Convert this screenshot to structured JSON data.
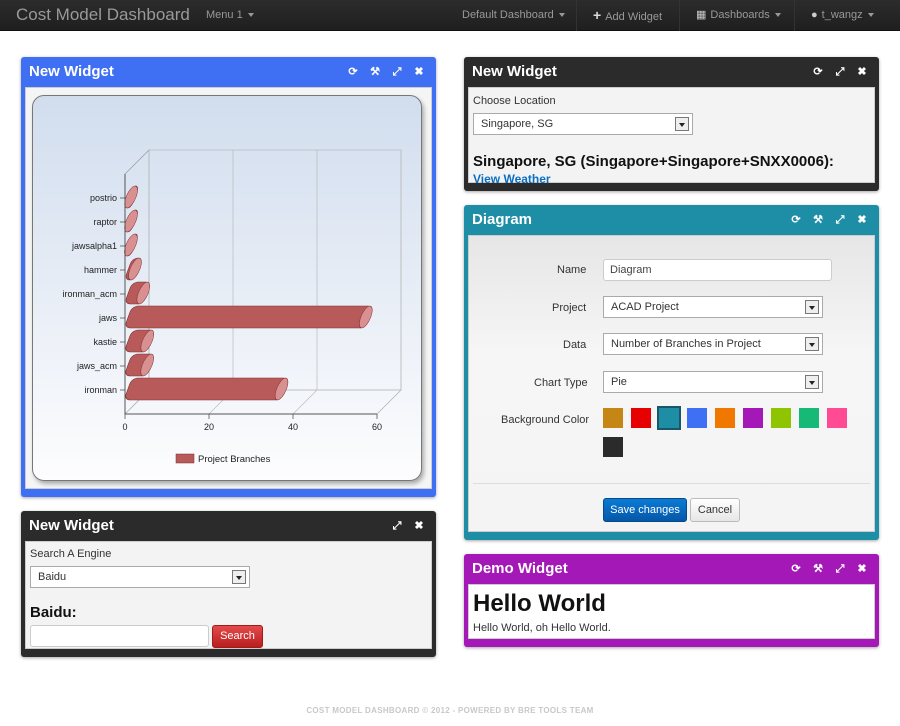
{
  "navbar": {
    "brand": "Cost Model Dashboard",
    "menu1": "Menu 1",
    "default_dashboard": "Default Dashboard",
    "add_widget": "Add Widget",
    "dashboards": "Dashboards",
    "user": "t_wangz"
  },
  "widget_chart": {
    "title": "New Widget",
    "chart_data": {
      "type": "bar",
      "orientation": "horizontal",
      "categories": [
        "postrio",
        "raptor",
        "jawsalpha1",
        "hammer",
        "ironman_acm",
        "jaws",
        "kastie",
        "jaws_acm",
        "ironman"
      ],
      "series": [
        {
          "name": "Project Branches",
          "values": [
            2,
            2,
            2,
            3,
            5,
            58,
            6,
            6,
            38
          ]
        }
      ],
      "xlim": [
        0,
        60
      ],
      "xticks": [
        "0",
        "20",
        "40",
        "60"
      ],
      "grid": true,
      "legend": "bottom",
      "color": "#b85a5a"
    }
  },
  "widget_location": {
    "title": "New Widget",
    "choose_label": "Choose Location",
    "selected": "Singapore, SG",
    "heading": "Singapore, SG (Singapore+Singapore+SNXX0006):",
    "link": "View Weather"
  },
  "widget_diagram": {
    "title": "Diagram",
    "name_label": "Name",
    "name_value": "Diagram",
    "project_label": "Project",
    "project_value": "ACAD Project",
    "data_label": "Data",
    "data_value": "Number of Branches in Project",
    "chart_type_label": "Chart Type",
    "chart_type_value": "Pie",
    "bg_label": "Background Color",
    "colors": [
      "#c58615",
      "#e60000",
      "#1e8ea6",
      "#3f6ff2",
      "#f07800",
      "#a318b7",
      "#8fc400",
      "#17b977",
      "#ff4a94",
      "#2b2b2b"
    ],
    "save": "Save changes",
    "cancel": "Cancel"
  },
  "widget_search": {
    "title": "New Widget",
    "engine_label": "Search A Engine",
    "selected": "Baidu",
    "heading": "Baidu:",
    "search_button": "Search"
  },
  "widget_demo": {
    "title": "Demo Widget",
    "heading": "Hello World",
    "text": "Hello World, oh Hello World."
  },
  "footer": "COST MODEL DASHBOARD © 2012 - POWERED BY BRE TOOLS TEAM"
}
